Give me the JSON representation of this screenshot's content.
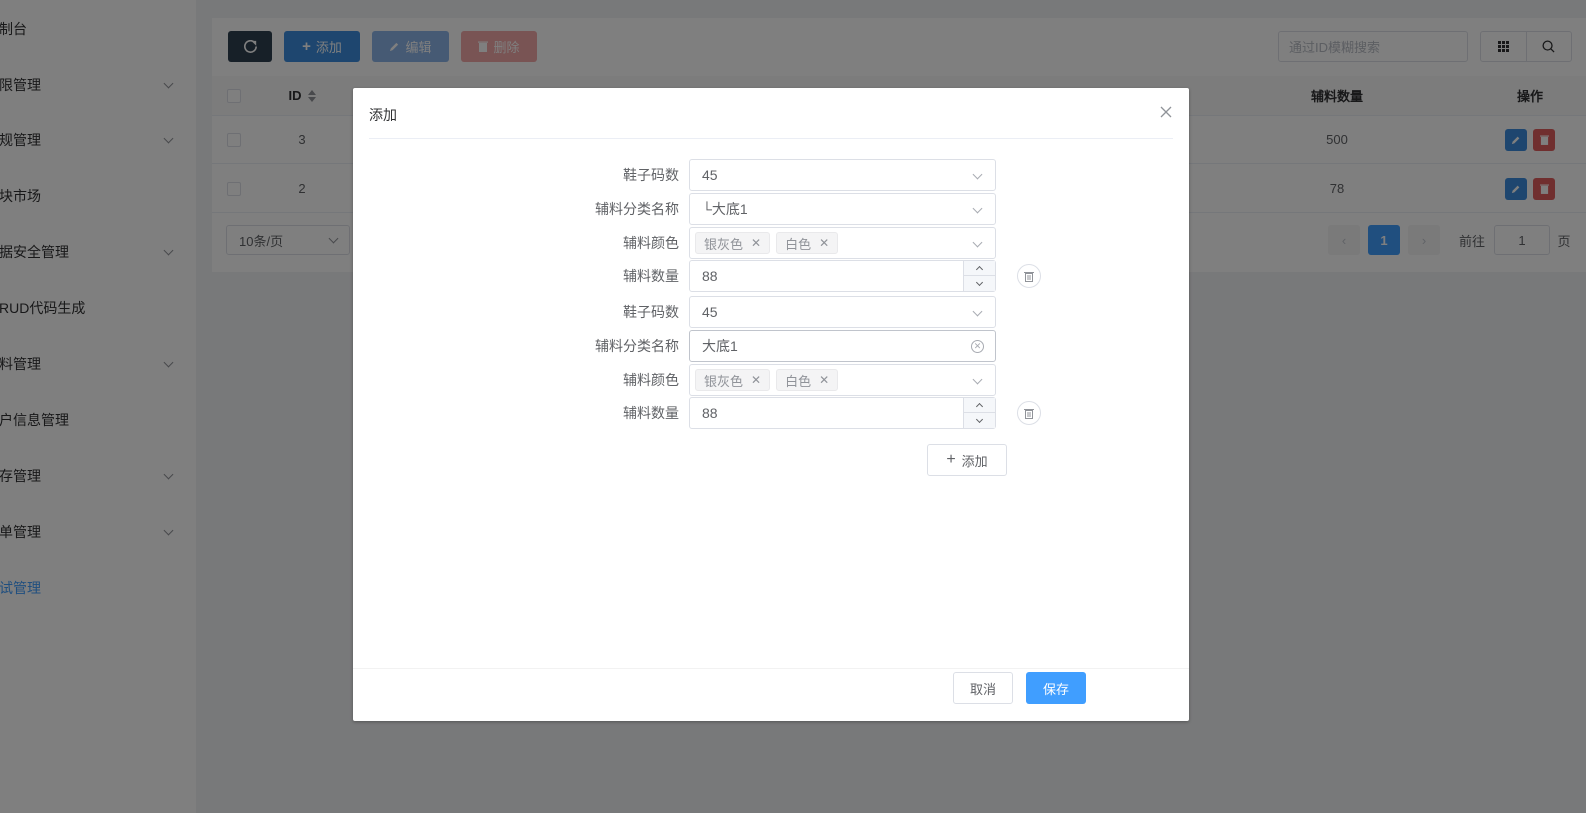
{
  "sidebar": {
    "items": [
      {
        "label": "制台",
        "has_arrow": false
      },
      {
        "label": "限管理",
        "has_arrow": true
      },
      {
        "label": "规管理",
        "has_arrow": true
      },
      {
        "label": "块市场",
        "has_arrow": false
      },
      {
        "label": "据安全管理",
        "has_arrow": true
      },
      {
        "label": "RUD代码生成",
        "has_arrow": false
      },
      {
        "label": "料管理",
        "has_arrow": true
      },
      {
        "label": "户信息管理",
        "has_arrow": false
      },
      {
        "label": "存管理",
        "has_arrow": true
      },
      {
        "label": "单管理",
        "has_arrow": true
      },
      {
        "label": "试管理",
        "has_arrow": false,
        "active": true
      }
    ]
  },
  "toolbar": {
    "refresh_icon": "refresh-icon",
    "add_label": "添加",
    "edit_label": "编辑",
    "delete_label": "删除",
    "search_placeholder": "通过ID模糊搜索"
  },
  "table": {
    "columns": {
      "id": "ID",
      "quantity": "辅料数量",
      "actions": "操作"
    },
    "rows": [
      {
        "id": "3",
        "quantity": "500"
      },
      {
        "id": "2",
        "quantity": "78"
      }
    ]
  },
  "pagination": {
    "page_size": "10条/页",
    "current_page": "1",
    "goto_prefix": "前往",
    "goto_value": "1",
    "goto_suffix": "页"
  },
  "dialog": {
    "title": "添加",
    "groups": [
      {
        "size_label": "鞋子码数",
        "size_value": "45",
        "category_label": "辅料分类名称",
        "category_value": "└大底1",
        "color_label": "辅料颜色",
        "colors": [
          "银灰色",
          "白色"
        ],
        "qty_label": "辅料数量",
        "qty_value": "88"
      },
      {
        "size_label": "鞋子码数",
        "size_value": "45",
        "category_label": "辅料分类名称",
        "category_value": "大底1",
        "color_label": "辅料颜色",
        "colors": [
          "银灰色",
          "白色"
        ],
        "qty_label": "辅料数量",
        "qty_value": "88"
      }
    ],
    "add_row_label": "添加",
    "cancel_label": "取消",
    "save_label": "保存"
  },
  "colors": {
    "primary": "#409eff",
    "sidebar_dark": "#2f4050",
    "danger": "#e05f5f"
  }
}
